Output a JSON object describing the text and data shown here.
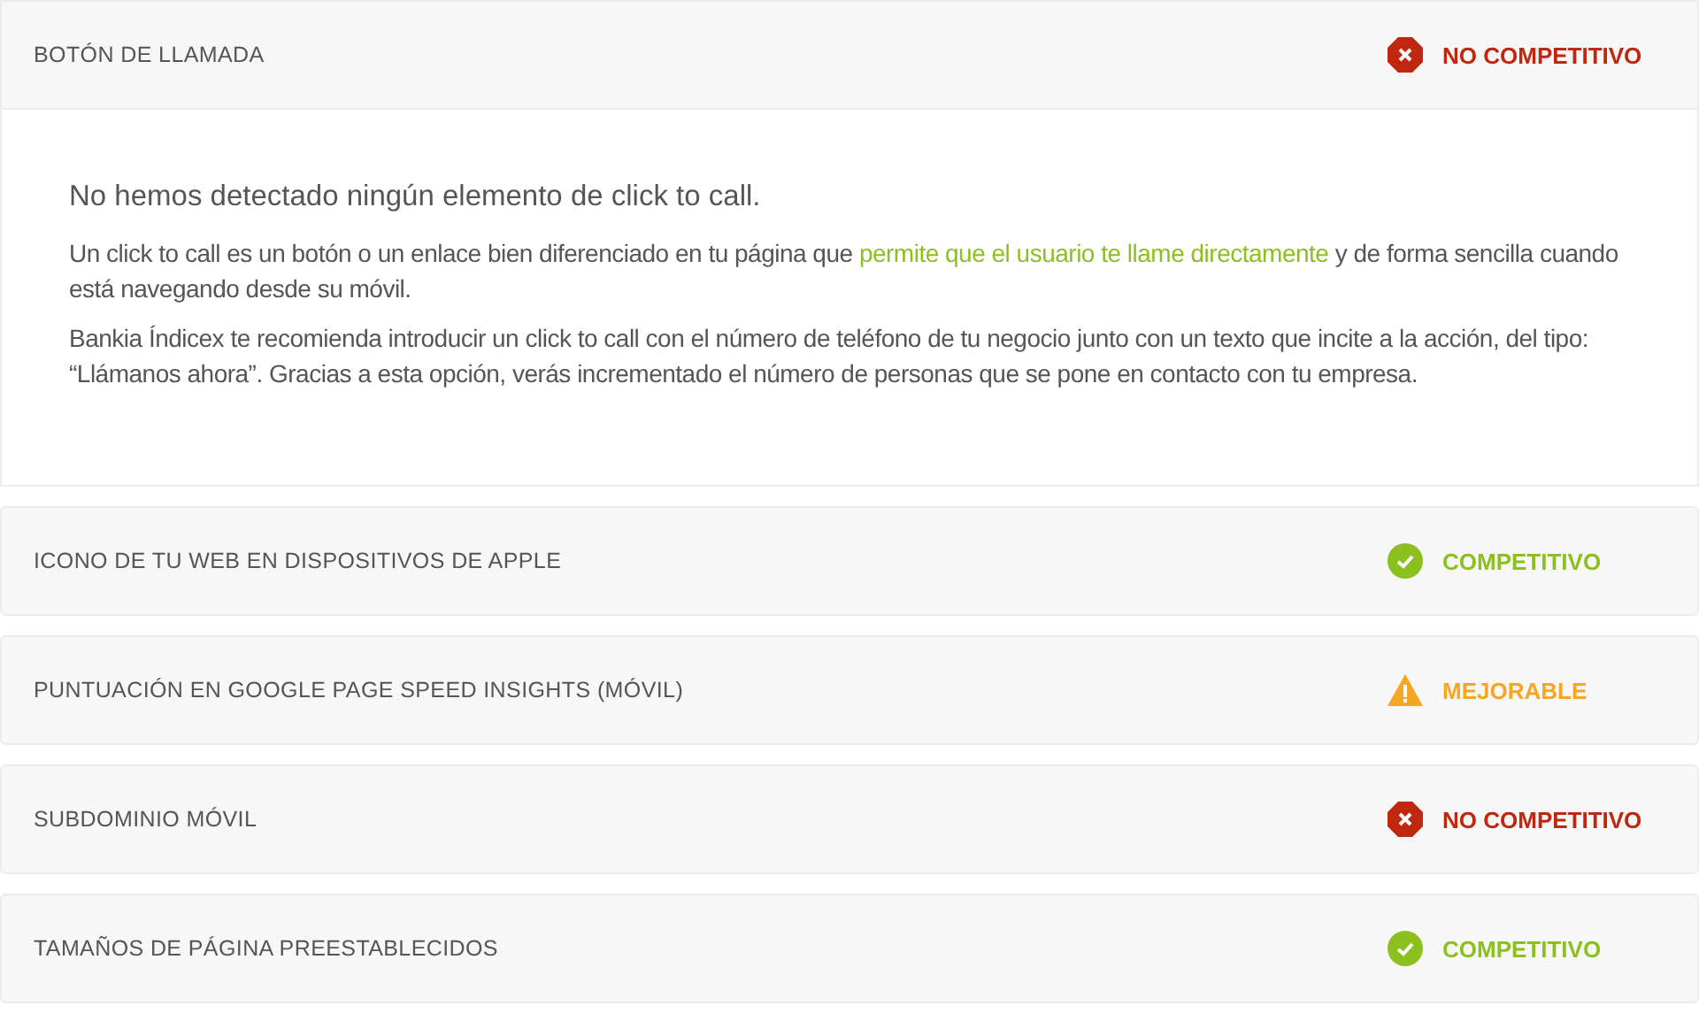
{
  "sections": [
    {
      "title": "BOTÓN DE LLAMADA",
      "status": {
        "kind": "bad",
        "label": "NO COMPETITIVO"
      },
      "expanded": true,
      "body": {
        "heading": "No hemos detectado ningún elemento de click to call.",
        "paragraphs": [
          {
            "before": "Un click to call es un botón o un enlace bien diferenciado en tu página que ",
            "link": "permite que el usuario te llame directamente",
            "after": " y de forma sencilla cuando está navegando desde su móvil."
          },
          {
            "before": "Bankia Índicex te recomienda introducir un click to call con el número de teléfono de tu negocio junto con un texto que incite a la acción, del tipo: “Llámanos ahora”. Gracias a esta opción, verás incrementado el número de personas que se pone en contacto con tu empresa."
          }
        ]
      }
    },
    {
      "title": "ICONO DE TU WEB EN DISPOSITIVOS DE APPLE",
      "status": {
        "kind": "good",
        "label": "COMPETITIVO"
      },
      "expanded": false
    },
    {
      "title": "PUNTUACIÓN EN GOOGLE PAGE SPEED INSIGHTS (MÓVIL)",
      "status": {
        "kind": "warn",
        "label": "MEJORABLE"
      },
      "expanded": false
    },
    {
      "title": "SUBDOMINIO MÓVIL",
      "status": {
        "kind": "bad",
        "label": "NO COMPETITIVO"
      },
      "expanded": false
    },
    {
      "title": "TAMAÑOS DE PÁGINA PREESTABLECIDOS",
      "status": {
        "kind": "good",
        "label": "COMPETITIVO"
      },
      "expanded": false
    }
  ]
}
